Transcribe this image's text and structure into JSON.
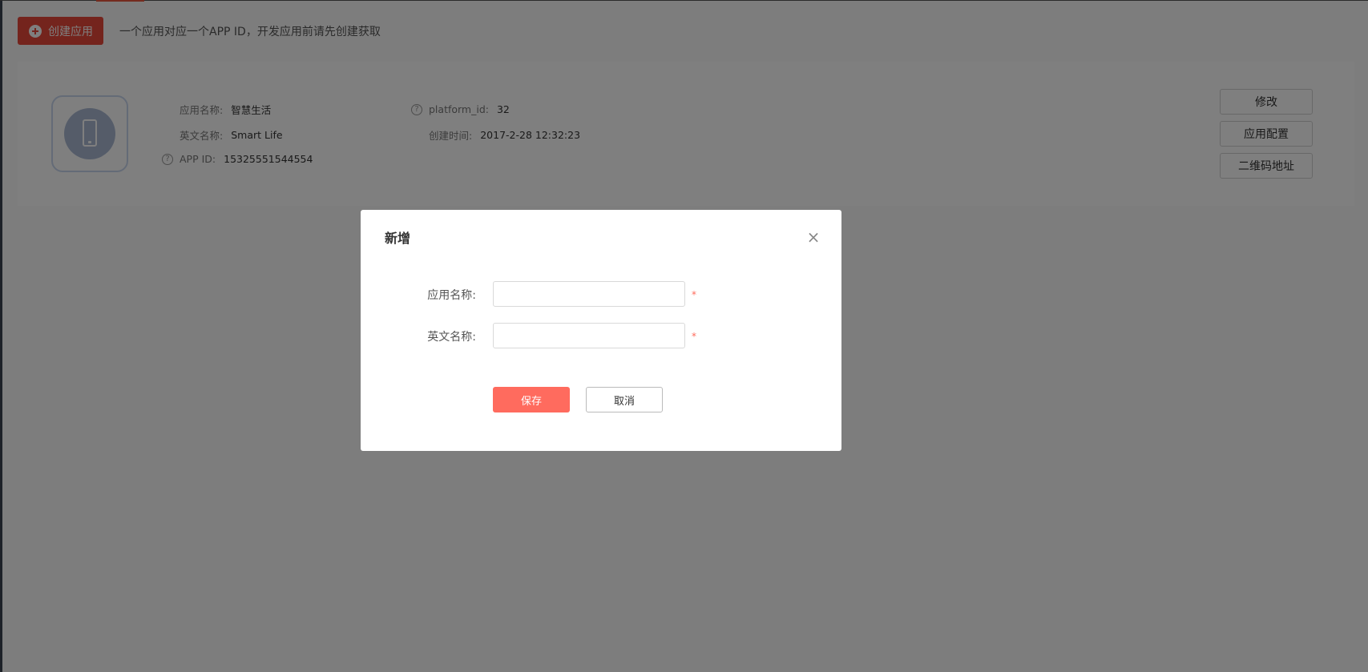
{
  "toolbar": {
    "create_label": "创建应用",
    "hint": "一个应用对应一个APP ID，开发应用前请先创建获取"
  },
  "app": {
    "name_label": "应用名称:",
    "name_value": "智慧生活",
    "english_label": "英文名称:",
    "english_value": "Smart Life",
    "appid_label": "APP ID:",
    "appid_value": "15325551544554",
    "platform_label": "platform_id:",
    "platform_value": "32",
    "created_label": "创建时间:",
    "created_value": "2017-2-28 12:32:23"
  },
  "actions": {
    "edit": "修改",
    "config": "应用配置",
    "qrcode": "二维码地址"
  },
  "modal": {
    "title": "新增",
    "close": "×",
    "fields": [
      {
        "label": "应用名称:",
        "value": "",
        "required": "*"
      },
      {
        "label": "英文名称:",
        "value": "",
        "required": "*"
      }
    ],
    "save": "保存",
    "cancel": "取消"
  },
  "colors": {
    "accent": "#e9483a",
    "save": "#ff6b5e",
    "icon_circle": "#aab9d3"
  },
  "icons": {
    "create": "plus-circle-icon",
    "app": "mobile-phone-icon",
    "help": "question-circle-icon",
    "close": "close-icon"
  }
}
